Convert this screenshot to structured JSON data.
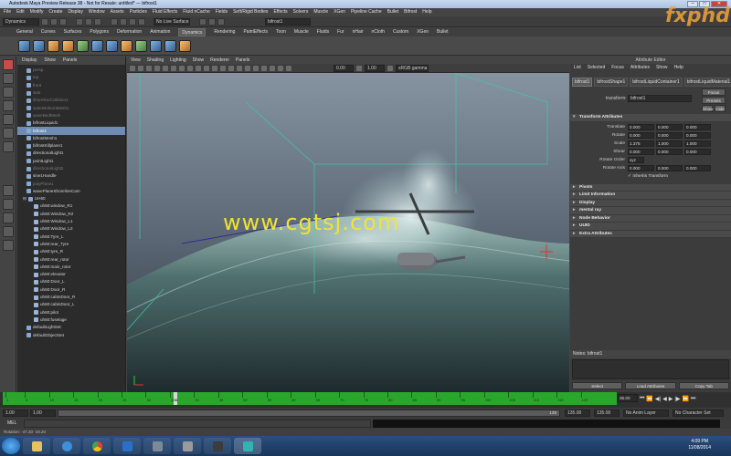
{
  "window": {
    "title": "Autodesk Maya Preview Release 38 - Not for Resale: untitled*   ---   bifrost1"
  },
  "menubar": [
    "File",
    "Edit",
    "Modify",
    "Create",
    "Display",
    "Window",
    "Assets",
    "Particles",
    "Fluid Effects",
    "Fluid nCache",
    "Fields",
    "Soft/Rigid Bodies",
    "Effects",
    "Solvers",
    "Muscle",
    "XGen",
    "Pipeline Cache",
    "Bullet",
    "Bifrost",
    "Help"
  ],
  "statusline": {
    "menuset": "Dynamics",
    "live_surface": "No Live Surface",
    "object_field": "bifrost1"
  },
  "shelf_tabs": [
    "General",
    "Curves",
    "Surfaces",
    "Polygons",
    "Deformation",
    "Animation",
    "Dynamics",
    "Rendering",
    "PaintEffects",
    "Toon",
    "Muscle",
    "Fluids",
    "Fur",
    "nHair",
    "nCloth",
    "Custom",
    "XGen",
    "Bullet"
  ],
  "shelf_active": "Dynamics",
  "outliner": {
    "menu": [
      "Display",
      "Show",
      "Panels"
    ],
    "items": [
      {
        "label": "persp",
        "dim": true
      },
      {
        "label": "top",
        "dim": true
      },
      {
        "label": "front",
        "dim": true
      },
      {
        "label": "side",
        "dim": true
      },
      {
        "label": "shorelineCollision1",
        "dim": true
      },
      {
        "label": "waterBottomMesh1",
        "dim": true
      },
      {
        "label": "waveBedMesh",
        "dim": true
      },
      {
        "label": "bifrostLiquid1",
        "dim": false
      },
      {
        "label": "bifrost1",
        "dim": false,
        "selected": true
      },
      {
        "label": "bifrostMesh1",
        "dim": false
      },
      {
        "label": "bifrostKillplane1",
        "dim": false
      },
      {
        "label": "directionalLight1",
        "dim": false
      },
      {
        "label": "pointLight1",
        "dim": false
      },
      {
        "label": "directionalLight2",
        "dim": true
      },
      {
        "label": "sine1Handle",
        "dim": false
      },
      {
        "label": "polyPlane1",
        "dim": true
      },
      {
        "label": "wavePlaneShorelineCam",
        "dim": false
      },
      {
        "label": "UH60",
        "dim": false,
        "group": true
      },
      {
        "label": "uh60:window_R1",
        "dim": false,
        "child": true
      },
      {
        "label": "uh60:Window_R2",
        "dim": false,
        "child": true
      },
      {
        "label": "uh60:Window_L1",
        "dim": false,
        "child": true
      },
      {
        "label": "uh60:Window_L2",
        "dim": false,
        "child": true
      },
      {
        "label": "uh60:Tyre_L",
        "dim": false,
        "child": true
      },
      {
        "label": "uh60:rear_Tyre",
        "dim": false,
        "child": true
      },
      {
        "label": "uh60:tyre_R",
        "dim": false,
        "child": true
      },
      {
        "label": "uh60:rear_rotor",
        "dim": false,
        "child": true
      },
      {
        "label": "uh60:main_rotor",
        "dim": false,
        "child": true
      },
      {
        "label": "uh60:elevator",
        "dim": false,
        "child": true
      },
      {
        "label": "uh60:Door_L",
        "dim": false,
        "child": true
      },
      {
        "label": "uh60:Door_R",
        "dim": false,
        "child": true
      },
      {
        "label": "uh60:cabinDoor_R",
        "dim": false,
        "child": true
      },
      {
        "label": "uh60:cabinDoor_L",
        "dim": false,
        "child": true
      },
      {
        "label": "uh60:pilot",
        "dim": false,
        "child": true
      },
      {
        "label": "uh60:fuselage",
        "dim": false,
        "child": true
      },
      {
        "label": "defaultLightSet",
        "dim": false
      },
      {
        "label": "defaultObjectSet",
        "dim": false
      }
    ]
  },
  "viewport": {
    "menu": [
      "View",
      "Shading",
      "Lighting",
      "Show",
      "Renderer",
      "Panels"
    ],
    "fields": {
      "near": "0.00",
      "far": "1.00",
      "gamma": "sRGB gamma"
    }
  },
  "attribute_editor": {
    "title": "Attribute Editor",
    "menu": [
      "List",
      "Selected",
      "Focus",
      "Attributes",
      "Show",
      "Help"
    ],
    "tabs": [
      "bifrost1",
      "bifrostShape1",
      "bifrostLiquidContainer1",
      "bifrostLiquidMaterial1"
    ],
    "transform_label": "transform:",
    "transform_value": "bifrost1",
    "focus_btn": "Focus",
    "presets_btn": "Presets",
    "show_btn": "Show",
    "hide_btn": "Hide",
    "section_transform": "Transform Attributes",
    "rows": [
      {
        "label": "Translate",
        "values": [
          "0.000",
          "0.000",
          "0.000"
        ]
      },
      {
        "label": "Rotate",
        "values": [
          "0.000",
          "0.000",
          "0.000"
        ]
      },
      {
        "label": "Scale",
        "values": [
          "1.375",
          "1.000",
          "1.000"
        ]
      },
      {
        "label": "Shear",
        "values": [
          "0.000",
          "0.000",
          "0.000"
        ]
      }
    ],
    "rotate_order_label": "Rotate Order",
    "rotate_order": "xyz",
    "rotate_axis_label": "Rotate Axis",
    "rotate_axis": [
      "0.000",
      "0.000",
      "0.000"
    ],
    "inherits": "Inherits Transform",
    "sections": [
      "Pivots",
      "Limit Information",
      "Display",
      "mental ray",
      "Node Behavior",
      "UUID",
      "Extra Attributes"
    ],
    "notes": "Notes:  bifrost1",
    "buttons": [
      "Select",
      "Load Attributes",
      "Copy Tab"
    ]
  },
  "timeline": {
    "ticks": [
      "1",
      "5",
      "10",
      "15",
      "20",
      "25",
      "30",
      "35",
      "40",
      "45",
      "50",
      "55",
      "60",
      "65",
      "70",
      "75",
      "80",
      "85",
      "90",
      "95",
      "100",
      "105",
      "110",
      "115",
      "120"
    ],
    "current_frame": "36",
    "current_field": "36.00",
    "range_start": "1.00",
    "range_start2": "1.00",
    "range_slider_end": "135",
    "range_end": "135.00",
    "range_end2": "135.00",
    "anim_layer": "No Anim Layer",
    "char_set": "No Character Set"
  },
  "command": {
    "lang": "MEL"
  },
  "help_line": "Rotation: -47.20   -19.20",
  "taskbar": {
    "time": "4:09 PM",
    "date": "11/08/2014"
  },
  "overlay": {
    "watermark": "www.cgtsj.com",
    "logo": "fxphd"
  }
}
